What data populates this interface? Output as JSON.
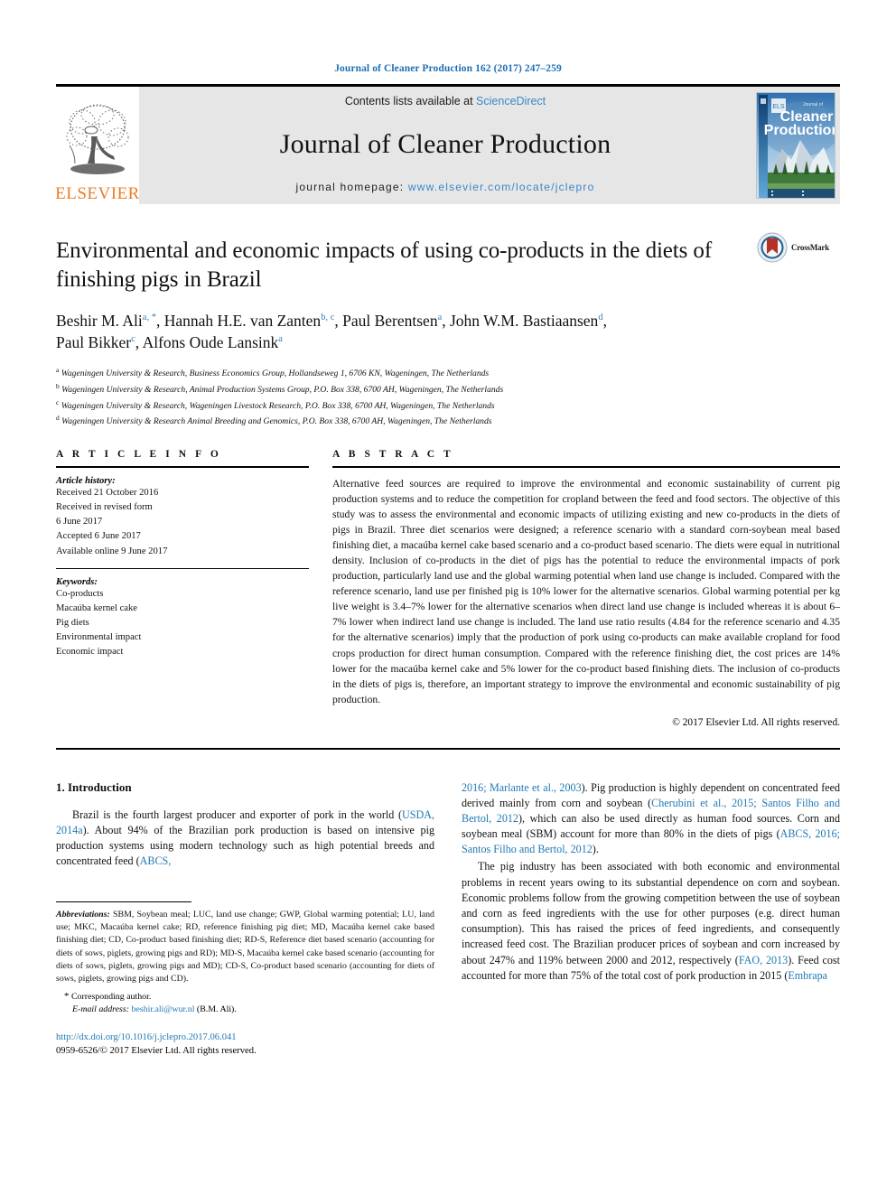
{
  "running_head": "Journal of Cleaner Production 162 (2017) 247–259",
  "masthead": {
    "publisher_name": "ELSEVIER",
    "contents_prefix": "Contents lists available at ",
    "contents_link": "ScienceDirect",
    "journal_title": "Journal of Cleaner Production",
    "homepage_prefix": "journal homepage: ",
    "homepage_url": "www.elsevier.com/locate/jclepro",
    "cover_title_line1": "Cleaner",
    "cover_title_line2": "Production",
    "cover_kicker": "Journal of"
  },
  "crossmark": {
    "label": "CrossMark"
  },
  "article": {
    "title": "Environmental and economic impacts of using co-products in the diets of finishing pigs in Brazil",
    "authors_line1_a": "Beshir M. Ali",
    "authors_sup1": "a, *",
    "authors_line1_b": ", Hannah H.E. van Zanten",
    "authors_sup2": "b, c",
    "authors_line1_c": ", Paul Berentsen",
    "authors_sup3": "a",
    "authors_line1_d": ", John W.M. Bastiaansen",
    "authors_sup4": "d",
    "authors_line2_a": "Paul Bikker",
    "authors_sup5": "c",
    "authors_line2_b": ", Alfons Oude Lansink",
    "authors_sup6": "a",
    "affiliations": [
      {
        "mark": "a",
        "text": "Wageningen University & Research, Business Economics Group, Hollandseweg 1, 6706 KN, Wageningen, The Netherlands"
      },
      {
        "mark": "b",
        "text": "Wageningen University & Research, Animal Production Systems Group, P.O. Box 338, 6700 AH, Wageningen, The Netherlands"
      },
      {
        "mark": "c",
        "text": "Wageningen University & Research, Wageningen Livestock Research, P.O. Box 338, 6700 AH, Wageningen, The Netherlands"
      },
      {
        "mark": "d",
        "text": "Wageningen University & Research Animal Breeding and Genomics, P.O. Box 338, 6700 AH, Wageningen, The Netherlands"
      }
    ]
  },
  "article_info": {
    "heading": "A R T I C L E  I N F O",
    "history_label": "Article history:",
    "history_lines": [
      "Received 21 October 2016",
      "Received in revised form",
      "6 June 2017",
      "Accepted 6 June 2017",
      "Available online 9 June 2017"
    ],
    "keywords_label": "Keywords:",
    "keywords": [
      "Co-products",
      "Macaúba kernel cake",
      "Pig diets",
      "Environmental impact",
      "Economic impact"
    ]
  },
  "abstract": {
    "heading": "A B S T R A C T",
    "text": "Alternative feed sources are required to improve the environmental and economic sustainability of current pig production systems and to reduce the competition for cropland between the feed and food sectors. The objective of this study was to assess the environmental and economic impacts of utilizing existing and new co-products in the diets of pigs in Brazil. Three diet scenarios were designed; a reference scenario with a standard corn-soybean meal based finishing diet, a macaúba kernel cake based scenario and a co-product based scenario. The diets were equal in nutritional density. Inclusion of co-products in the diet of pigs has the potential to reduce the environmental impacts of pork production, particularly land use and the global warming potential when land use change is included. Compared with the reference scenario, land use per finished pig is 10% lower for the alternative scenarios. Global warming potential per kg live weight is 3.4–7% lower for the alternative scenarios when direct land use change is included whereas it is about 6–7% lower when indirect land use change is included. The land use ratio results (4.84 for the reference scenario and 4.35 for the alternative scenarios) imply that the production of pork using co-products can make available cropland for food crops production for direct human consumption. Compared with the reference finishing diet, the cost prices are 14% lower for the macaúba kernel cake and 5% lower for the co-product based finishing diets. The inclusion of co-products in the diets of pigs is, therefore, an important strategy to improve the environmental and economic sustainability of pig production.",
    "copyright": "© 2017 Elsevier Ltd. All rights reserved."
  },
  "body": {
    "section_number_title": "1.  Introduction",
    "left_para1_part1": "Brazil is the fourth largest producer and exporter of pork in the world (",
    "left_para1_ref1": "USDA, 2014a",
    "left_para1_part2": "). About 94% of the Brazilian pork production is based on intensive pig production systems using modern technology such as high potential breeds and concentrated feed (",
    "left_para1_ref2": "ABCS,",
    "right_para1_ref_cont": "2016; Marlante et al., 2003",
    "right_para1_part1": "). Pig production is highly dependent on concentrated feed derived mainly from corn and soybean (",
    "right_para1_ref2": "Cherubini et al., 2015; Santos Filho and Bertol, 2012",
    "right_para1_part2": "), which can also be used directly as human food sources. Corn and soybean meal (SBM) account for more than 80% in the diets of pigs (",
    "right_para1_ref3": "ABCS, 2016; Santos Filho and Bertol, 2012",
    "right_para1_part3": ").",
    "right_para2_part1": "The pig industry has been associated with both economic and environmental problems in recent years owing to its substantial dependence on corn and soybean. Economic problems follow from the growing competition between the use of soybean and corn as feed ingredients with the use for other purposes (e.g. direct human consumption). This has raised the prices of feed ingredients, and consequently increased feed cost. The Brazilian producer prices of soybean and corn increased by about 247% and 119% between 2000 and 2012, respectively (",
    "right_para2_ref1": "FAO, 2013",
    "right_para2_part2": "). Feed cost accounted for more than 75% of the total cost of pork production in 2015 (",
    "right_para2_ref2": "Embrapa"
  },
  "footnotes": {
    "abbrev_label": "Abbreviations:",
    "abbrev_text": " SBM, Soybean meal; LUC, land use change; GWP, Global warming potential; LU, land use; MKC, Macaúba kernel cake; RD, reference finishing pig diet; MD, Macaúba kernel cake based finishing diet; CD, Co-product based finishing diet; RD-S, Reference diet based scenario (accounting for diets of sows, piglets, growing pigs and RD); MD-S, Macaúba kernel cake based scenario (accounting for diets of sows, piglets, growing pigs and MD); CD-S, Co-product based scenario (accounting for diets of sows, piglets, growing pigs and CD).",
    "corresponding": "Corresponding author.",
    "email_label": "E-mail address:",
    "email": "beshir.ali@wur.nl",
    "email_suffix": " (B.M. Ali).",
    "doi": "http://dx.doi.org/10.1016/j.jclepro.2017.06.041",
    "issn_line": "0959-6526/© 2017 Elsevier Ltd. All rights reserved."
  },
  "colors": {
    "link": "#2179b5",
    "elsevier_orange": "#ec7c26",
    "masthead_bg": "#e6e6e6",
    "crossmark_red": "#b4312a"
  }
}
